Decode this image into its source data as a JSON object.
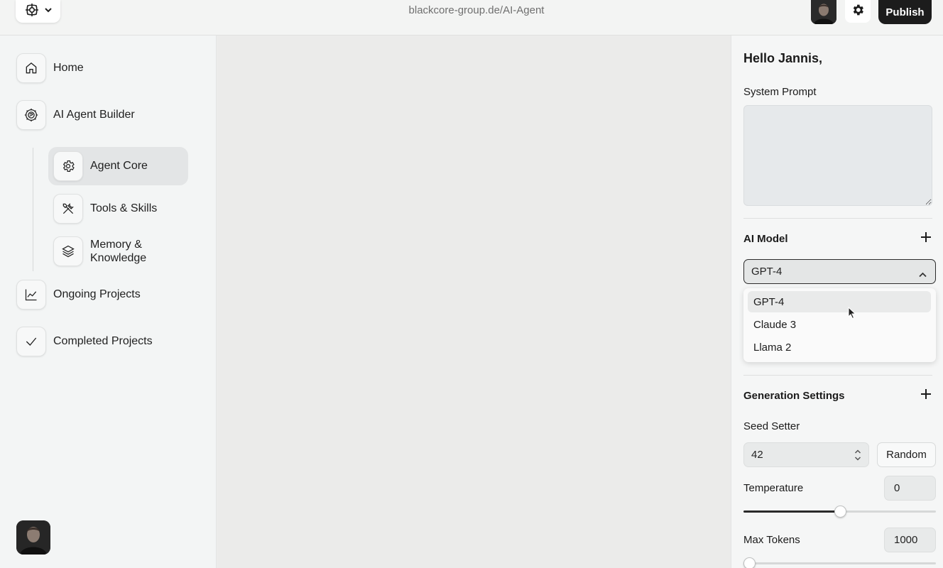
{
  "topbar": {
    "url": "blackcore-group.de/AI-Agent",
    "publish_label": "Publish"
  },
  "icons": {
    "logo": "network-logo-icon",
    "chevron": "chevron-down-icon",
    "settings": "gear-icon"
  },
  "sidebar": {
    "items": [
      {
        "label": "Home",
        "icon": "home-icon"
      },
      {
        "label": "AI Agent Builder",
        "icon": "brain-gear-icon"
      },
      {
        "label": "Ongoing Projects",
        "icon": "line-chart-icon"
      },
      {
        "label": "Completed Projects",
        "icon": "checkmark-icon"
      }
    ],
    "sub_items": [
      {
        "label": "Agent Core",
        "icon": "gear-icon",
        "active": true
      },
      {
        "label": "Tools & Skills",
        "icon": "tools-icon"
      },
      {
        "label": "Memory & Knowledge",
        "icon": "layers-icon"
      }
    ]
  },
  "panel": {
    "greeting": "Hello Jannis,",
    "system_prompt_label": "System Prompt",
    "system_prompt_value": "",
    "ai_model_title": "AI Model",
    "selected_model": "GPT-4",
    "model_options": [
      "GPT-4",
      "Claude 3",
      "Llama 2"
    ],
    "generation_title": "Generation Settings",
    "seed_label": "Seed Setter",
    "seed_value": "42",
    "random_label": "Random",
    "temperature_label": "Temperature",
    "temperature_value": "0",
    "temperature_slider_fraction": 0.5,
    "max_tokens_label": "Max Tokens",
    "max_tokens_value": "1000",
    "max_tokens_slider_fraction": 0.02
  },
  "colors": {
    "primary_button": "#1c1c1c",
    "active_nav_bg": "#e3e5e6"
  }
}
